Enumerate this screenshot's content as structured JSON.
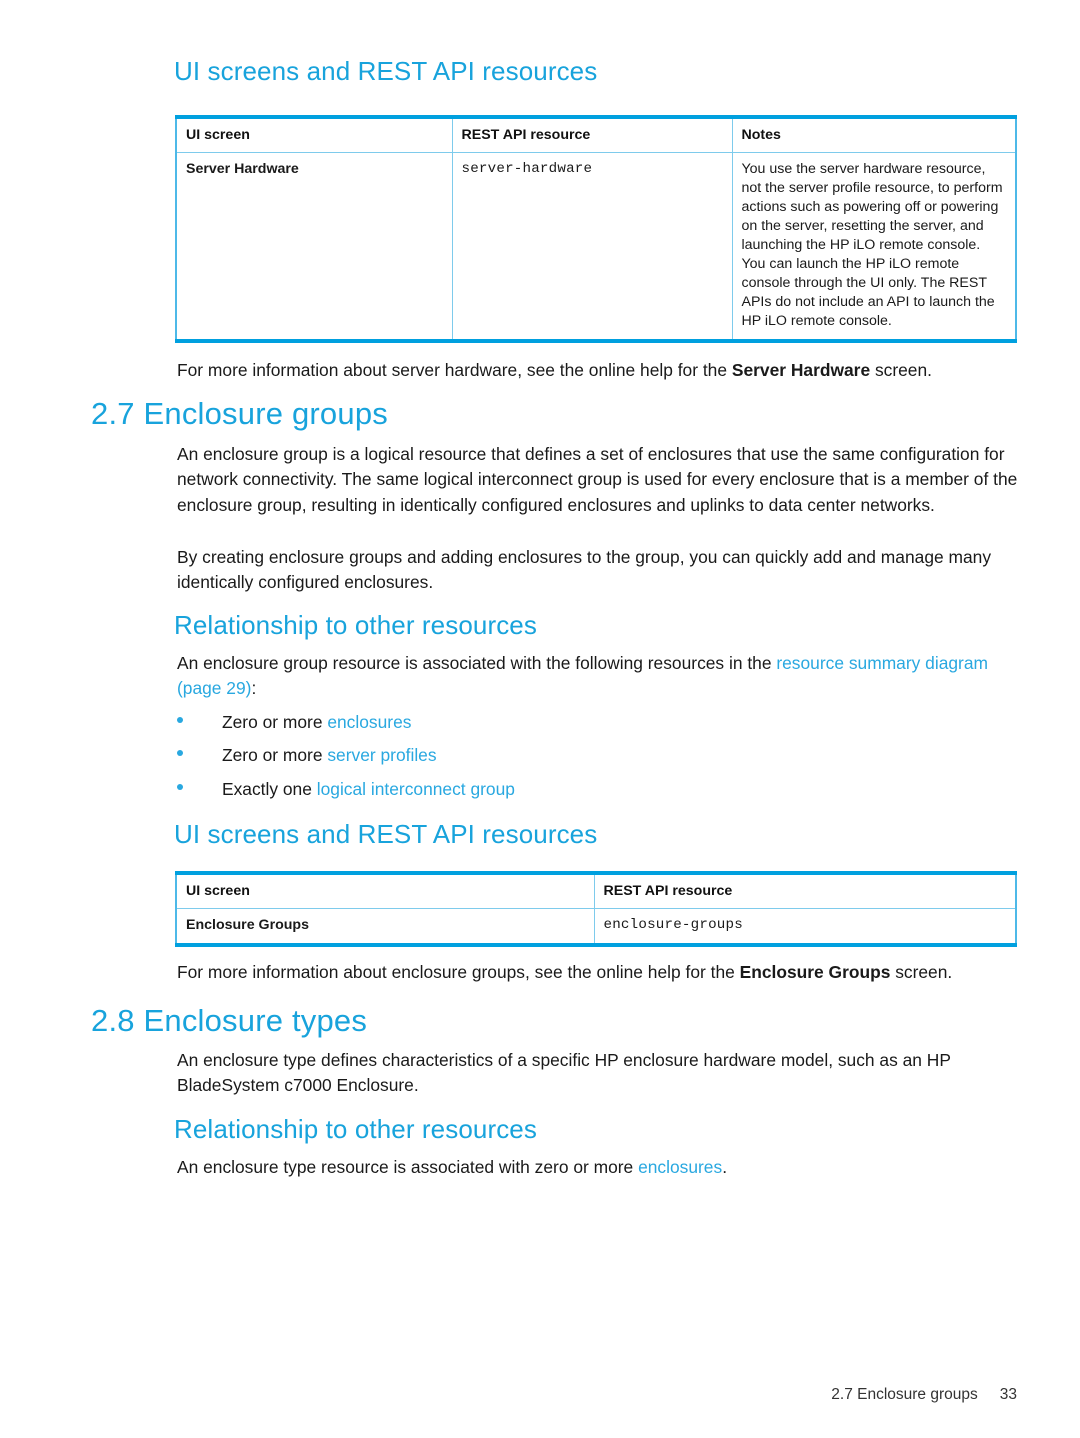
{
  "headings": {
    "ui_rest_1": "UI screens and REST API resources",
    "section_27": "2.7 Enclosure groups",
    "relationship_1": "Relationship to other resources",
    "ui_rest_2": "UI screens and REST API resources",
    "section_28": "2.8 Enclosure types",
    "relationship_2": "Relationship to other resources"
  },
  "table1": {
    "columns": [
      "UI screen",
      "REST API resource",
      "Notes"
    ],
    "rows": [
      {
        "ui_screen": "Server Hardware",
        "rest_api_resource": "server-hardware",
        "notes": "You use the server hardware resource, not the server profile resource, to perform actions such as powering off or powering on the server, resetting the server, and launching the HP iLO remote console. You can launch the HP iLO remote console through the UI only. The REST APIs do not include an API to launch the HP iLO remote console."
      }
    ]
  },
  "table2": {
    "columns": [
      "UI screen",
      "REST API resource"
    ],
    "rows": [
      {
        "ui_screen": "Enclosure Groups",
        "rest_api_resource": "enclosure-groups"
      }
    ]
  },
  "paragraphs": {
    "more_info_server_hardware": {
      "pre": "For more information about server hardware, see the online help for the ",
      "bold": "Server Hardware",
      "post": " screen."
    },
    "enclosure_group_def": "An enclosure group is a logical resource that defines a set of enclosures that use the same configuration for network connectivity. The same logical interconnect group is used for every enclosure that is a member of the enclosure group, resulting in identically configured enclosures and uplinks to data center networks.",
    "enclosure_group_creating": "By creating enclosure groups and adding enclosures to the group, you can quickly add and manage many identically configured enclosures.",
    "associated_intro": {
      "pre": "An enclosure group resource is associated with the following resources in the ",
      "link": "resource summary diagram (page 29)",
      "post": ":"
    },
    "more_info_enclosure_groups": {
      "pre": "For more information about enclosure groups, see the online help for the ",
      "bold": "Enclosure Groups",
      "post": " screen."
    },
    "enclosure_type_def": "An enclosure type defines characteristics of a specific HP enclosure hardware model, such as an HP BladeSystem c7000 Enclosure.",
    "enclosure_type_assoc": {
      "pre": "An enclosure type resource is associated with zero or more ",
      "link": "enclosures",
      "post": "."
    }
  },
  "bullets": [
    {
      "pre": "Zero or more ",
      "link": "enclosures",
      "post": ""
    },
    {
      "pre": "Zero or more ",
      "link": "server profiles",
      "post": ""
    },
    {
      "pre": "Exactly one ",
      "link": "logical interconnect group",
      "post": ""
    }
  ],
  "footer": {
    "section": "2.7 Enclosure groups",
    "page_number": "33"
  },
  "colors": {
    "heading_blue": "#18a3DC",
    "link_blue": "#29a8e0",
    "table_border_blue": "#00A0DF",
    "table_inner_blue": "#7ecbec"
  }
}
